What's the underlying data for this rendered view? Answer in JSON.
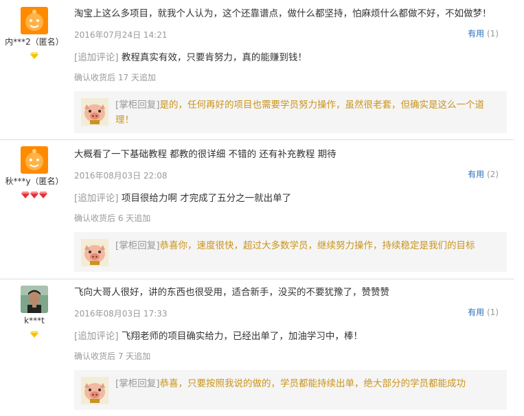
{
  "reviews": [
    {
      "user": "内***2（匿名）",
      "avatar": "taobao-default-avatar",
      "rank_icons": [
        "yellow-diamond"
      ],
      "text": "淘宝上这么多项目，就我个人认为，这个还靠谱点，做什么都坚持，怕麻烦什么都做不好，不如做梦！",
      "date": "2016年07月24日 14:21",
      "useful_label": "有用",
      "useful_count": "(1)",
      "append_tag": "[追加评论]",
      "append_text": "教程真实有效，只要肯努力，真的能赚到钱！",
      "append_meta": "确认收货后 17 天追加",
      "reply_tag": "[掌柜回复]",
      "reply_text": "是的，任何再好的项目也需要学员努力操作，虽然很老套，但确实是这么一个道理！"
    },
    {
      "user": "秋***y（匿名）",
      "avatar": "taobao-default-avatar",
      "rank_icons": [
        "red-heart",
        "red-heart",
        "red-heart"
      ],
      "text": "大概看了一下基础教程 都教的很详细 不错的 还有补充教程 期待",
      "date": "2016年08月03日 22:08",
      "useful_label": "有用",
      "useful_count": "(2)",
      "append_tag": "[追加评论]",
      "append_text": "项目很给力啊 才完成了五分之一就出单了",
      "append_meta": "确认收货后 6 天追加",
      "reply_tag": "[掌柜回复]",
      "reply_text": "恭喜你，速度很快，超过大多数学员，继续努力操作，持续稳定是我们的目标"
    },
    {
      "user": "k***t",
      "avatar": "user-photo-avatar",
      "rank_icons": [
        "yellow-diamond"
      ],
      "text": "飞向大哥人很好，讲的东西也很受用，适合新手，没买的不要犹豫了，赞赞赞",
      "date": "2016年08月03日 17:33",
      "useful_label": "有用",
      "useful_count": "(1)",
      "append_tag": "[追加评论]",
      "append_text": "飞翔老师的项目确实给力，已经出单了，加油学习中，棒！",
      "append_meta": "确认收货后 7 天追加",
      "reply_tag": "[掌柜回复]",
      "reply_text": "恭喜，只要按照我说的做的，学员都能持续出单，绝大部分的学员都能成功"
    }
  ]
}
